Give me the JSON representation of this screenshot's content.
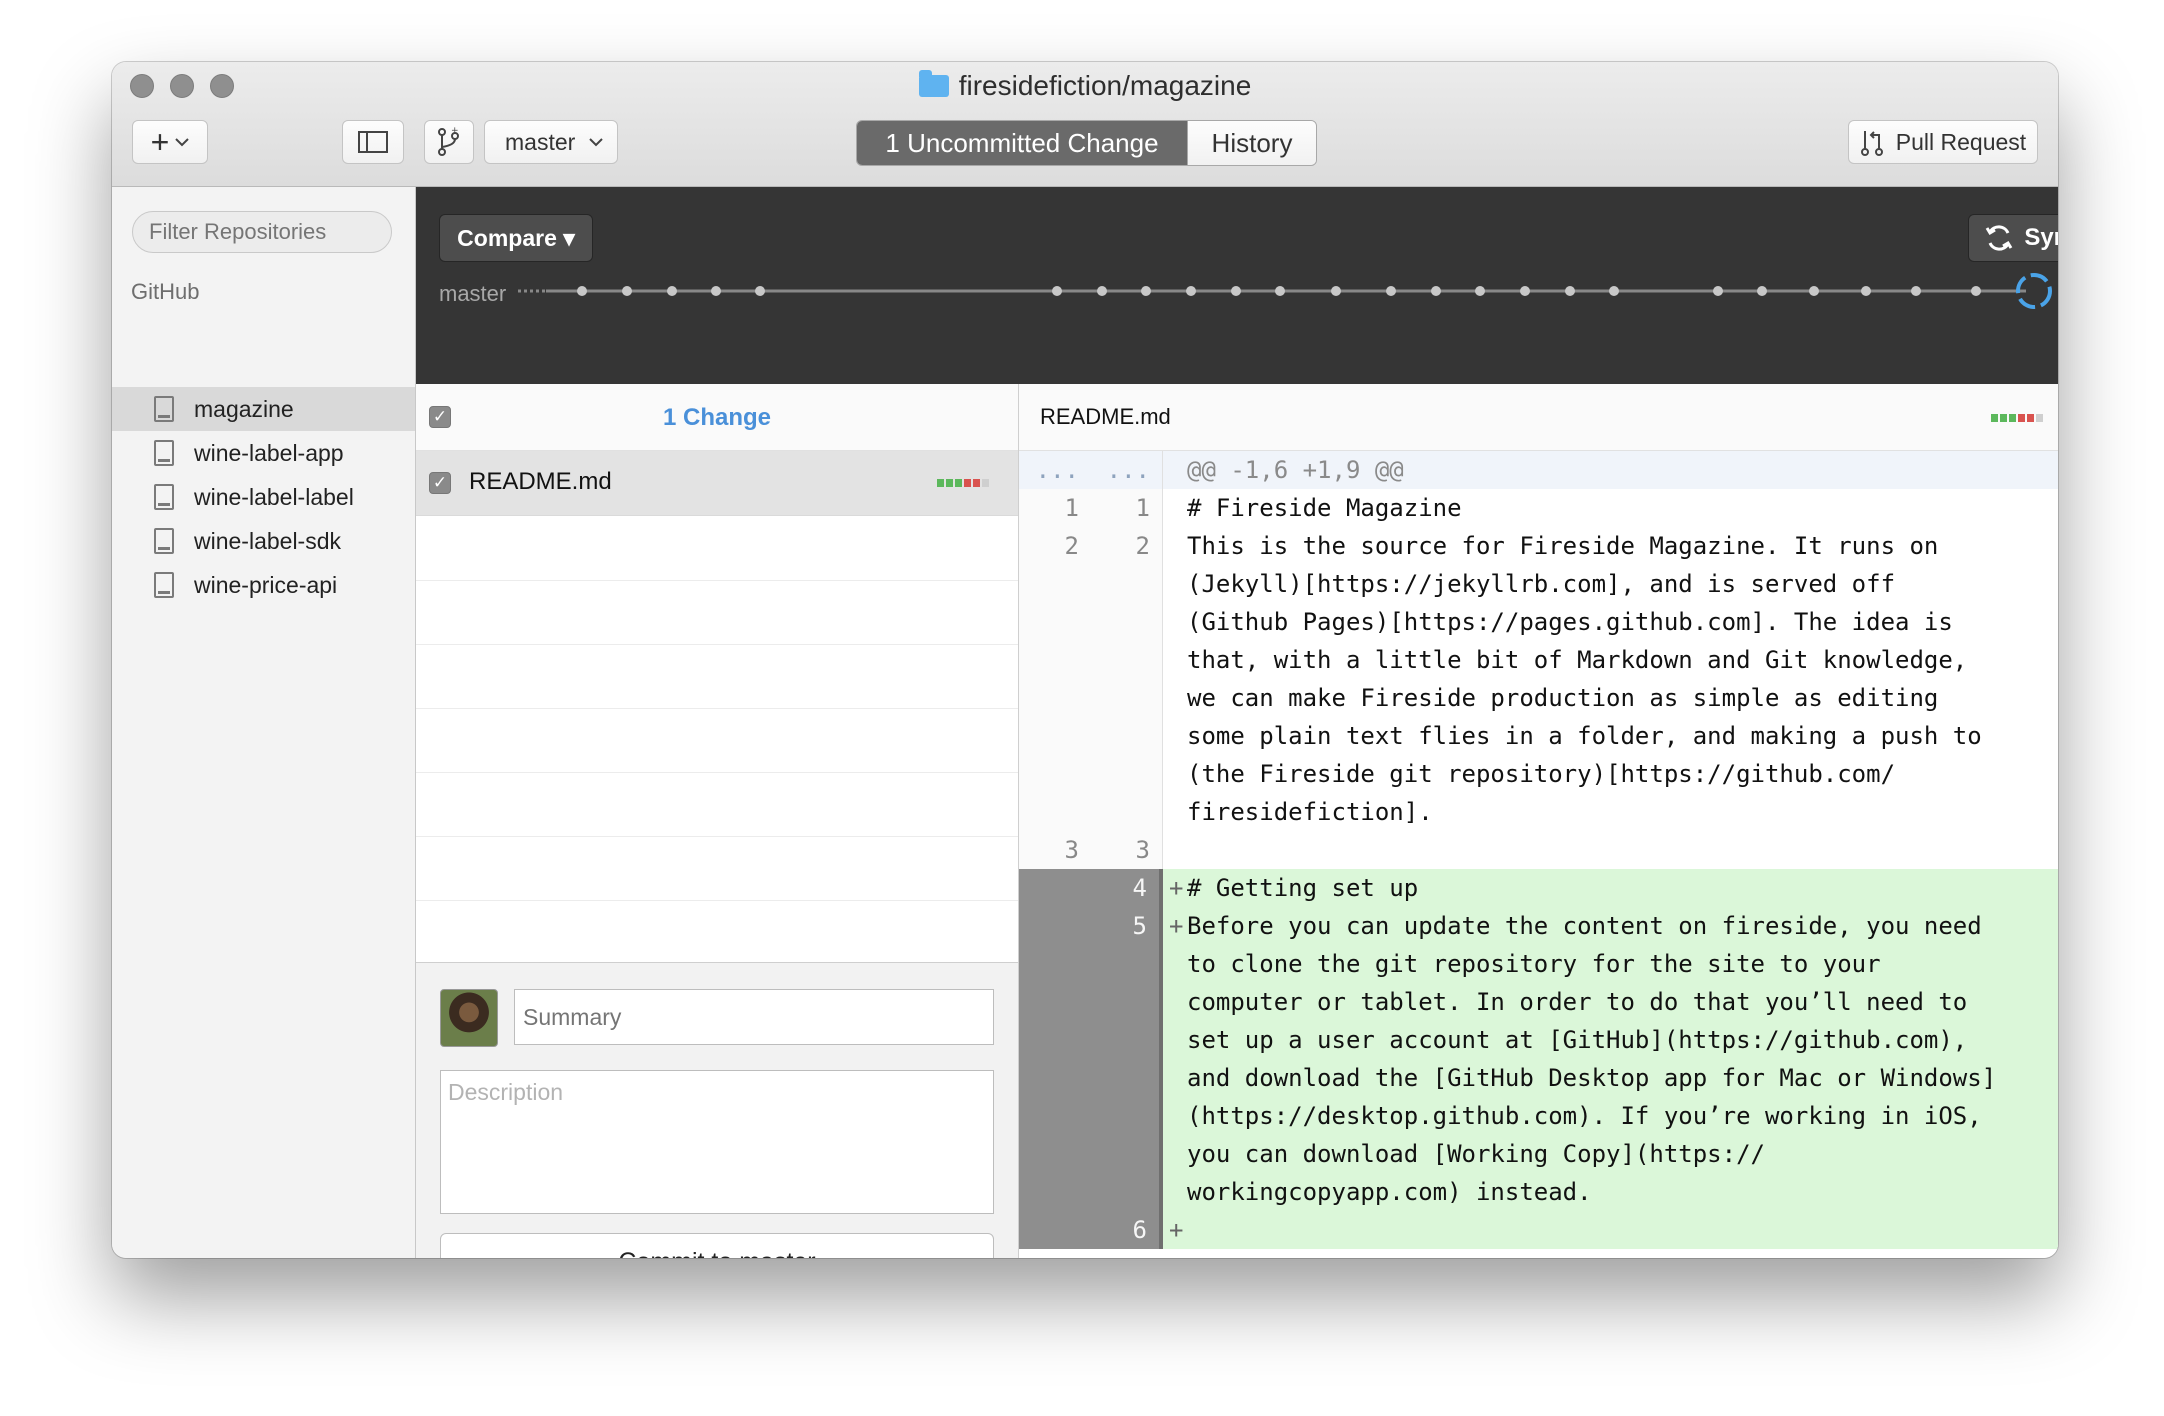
{
  "window": {
    "title": "firesidefiction/magazine"
  },
  "toolbar": {
    "add_label": "+",
    "branch_name": "master",
    "tabs": [
      {
        "label": "1 Uncommitted Change",
        "active": true
      },
      {
        "label": "History",
        "active": false
      }
    ],
    "pull_request_label": "Pull Request"
  },
  "sidebar": {
    "filter_placeholder": "Filter Repositories",
    "section": "GitHub",
    "repos": [
      {
        "name": "magazine",
        "selected": true
      },
      {
        "name": "wine-label-app",
        "selected": false
      },
      {
        "name": "wine-label-label",
        "selected": false
      },
      {
        "name": "wine-label-sdk",
        "selected": false
      },
      {
        "name": "wine-price-api",
        "selected": false
      }
    ]
  },
  "header": {
    "compare_label": "Compare ▾",
    "sync_label": "Sync",
    "branch_label": "master"
  },
  "changes": {
    "title": "1 Change",
    "files": [
      {
        "name": "README.md",
        "checked": true
      }
    ]
  },
  "commit": {
    "summary_placeholder": "Summary",
    "description_placeholder": "Description",
    "button_label": "Commit to master"
  },
  "diff": {
    "file": "README.md",
    "lines": [
      {
        "kind": "hunk",
        "old": "...",
        "new": "...",
        "sign": "",
        "text": "@@ -1,6 +1,9 @@"
      },
      {
        "kind": "ctx",
        "old": "1",
        "new": "1",
        "sign": "",
        "text": "# Fireside Magazine"
      },
      {
        "kind": "ctx",
        "old": "2",
        "new": "2",
        "sign": "",
        "text": "This is the source for Fireside Magazine. It runs on"
      },
      {
        "kind": "ctx",
        "old": "",
        "new": "",
        "sign": "",
        "text": "(Jekyll)[https://jekyllrb.com], and is served off"
      },
      {
        "kind": "ctx",
        "old": "",
        "new": "",
        "sign": "",
        "text": "(Github Pages)[https://pages.github.com]. The idea is"
      },
      {
        "kind": "ctx",
        "old": "",
        "new": "",
        "sign": "",
        "text": "that, with a little bit of Markdown and Git knowledge,"
      },
      {
        "kind": "ctx",
        "old": "",
        "new": "",
        "sign": "",
        "text": "we can make Fireside production as simple as editing"
      },
      {
        "kind": "ctx",
        "old": "",
        "new": "",
        "sign": "",
        "text": "some plain text flies in a folder, and making a push to"
      },
      {
        "kind": "ctx",
        "old": "",
        "new": "",
        "sign": "",
        "text": "(the Fireside git repository)[https://github.com/"
      },
      {
        "kind": "ctx",
        "old": "",
        "new": "",
        "sign": "",
        "text": "firesidefiction]."
      },
      {
        "kind": "ctx",
        "old": "3",
        "new": "3",
        "sign": "",
        "text": ""
      },
      {
        "kind": "add",
        "old": "",
        "new": "4",
        "sign": "+",
        "text": "# Getting set up"
      },
      {
        "kind": "add",
        "old": "",
        "new": "5",
        "sign": "+",
        "text": "Before you can update the content on fireside, you need"
      },
      {
        "kind": "add",
        "old": "",
        "new": "",
        "sign": "",
        "text": "to clone the git repository for the site to your"
      },
      {
        "kind": "add",
        "old": "",
        "new": "",
        "sign": "",
        "text": "computer or tablet. In order to do that you’ll need to"
      },
      {
        "kind": "add",
        "old": "",
        "new": "",
        "sign": "",
        "text": "set up a user account at [GitHub](https://github.com),"
      },
      {
        "kind": "add",
        "old": "",
        "new": "",
        "sign": "",
        "text": "and download the [GitHub Desktop app for Mac or Windows]"
      },
      {
        "kind": "add",
        "old": "",
        "new": "",
        "sign": "",
        "text": "(https://desktop.github.com). If you’re working in iOS,"
      },
      {
        "kind": "add",
        "old": "",
        "new": "",
        "sign": "",
        "text": "you can download [Working Copy](https://"
      },
      {
        "kind": "add",
        "old": "",
        "new": "",
        "sign": "",
        "text": "workingcopyapp.com) instead."
      },
      {
        "kind": "add",
        "old": "",
        "new": "6",
        "sign": "+",
        "text": ""
      }
    ]
  },
  "colors": {
    "accent": "#4a90d9",
    "added_bg": "#dbf7d9",
    "header_bg": "#353535",
    "diffstat_add": "#5cb85c",
    "diffstat_del": "#d9534f"
  }
}
